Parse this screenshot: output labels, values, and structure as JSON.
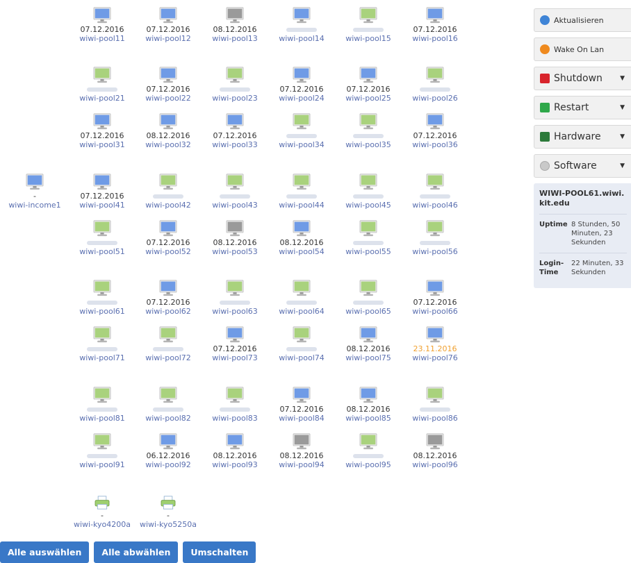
{
  "colors": {
    "monitor_blue": "#6f9be6",
    "monitor_green": "#a9d27d",
    "monitor_gray": "#9a9a9a",
    "link": "#5a6fb0",
    "button_blue": "#3978c7",
    "date_warning": "#f0a030"
  },
  "hosts": [
    {
      "name": "wiwi-income1",
      "date": "-",
      "state": "blue",
      "col": 0,
      "row": 3
    },
    {
      "name": "wiwi-pool11",
      "date": "07.12.2016",
      "state": "blue",
      "col": 1,
      "row": 0
    },
    {
      "name": "wiwi-pool12",
      "date": "07.12.2016",
      "state": "blue",
      "col": 2,
      "row": 0
    },
    {
      "name": "wiwi-pool13",
      "date": "08.12.2016",
      "state": "gray",
      "col": 3,
      "row": 0
    },
    {
      "name": "wiwi-pool14",
      "date": "",
      "state": "blue",
      "col": 4,
      "row": 0
    },
    {
      "name": "wiwi-pool15",
      "date": "",
      "state": "green",
      "col": 5,
      "row": 0
    },
    {
      "name": "wiwi-pool16",
      "date": "07.12.2016",
      "state": "blue",
      "col": 6,
      "row": 0
    },
    {
      "name": "wiwi-pool21",
      "date": "",
      "state": "green",
      "col": 1,
      "row": 1
    },
    {
      "name": "wiwi-pool22",
      "date": "07.12.2016",
      "state": "blue",
      "col": 2,
      "row": 1
    },
    {
      "name": "wiwi-pool23",
      "date": "",
      "state": "green",
      "col": 3,
      "row": 1
    },
    {
      "name": "wiwi-pool24",
      "date": "07.12.2016",
      "state": "blue",
      "col": 4,
      "row": 1
    },
    {
      "name": "wiwi-pool25",
      "date": "07.12.2016",
      "state": "blue",
      "col": 5,
      "row": 1
    },
    {
      "name": "wiwi-pool26",
      "date": "",
      "state": "green",
      "col": 6,
      "row": 1
    },
    {
      "name": "wiwi-pool31",
      "date": "07.12.2016",
      "state": "blue",
      "col": 1,
      "row": 2
    },
    {
      "name": "wiwi-pool32",
      "date": "08.12.2016",
      "state": "blue",
      "col": 2,
      "row": 2
    },
    {
      "name": "wiwi-pool33",
      "date": "07.12.2016",
      "state": "blue",
      "col": 3,
      "row": 2
    },
    {
      "name": "wiwi-pool34",
      "date": "",
      "state": "green",
      "col": 4,
      "row": 2
    },
    {
      "name": "wiwi-pool35",
      "date": "",
      "state": "green",
      "col": 5,
      "row": 2
    },
    {
      "name": "wiwi-pool36",
      "date": "07.12.2016",
      "state": "blue",
      "col": 6,
      "row": 2
    },
    {
      "name": "wiwi-pool41",
      "date": "07.12.2016",
      "state": "blue",
      "col": 1,
      "row": 3
    },
    {
      "name": "wiwi-pool42",
      "date": "",
      "state": "green",
      "col": 2,
      "row": 3
    },
    {
      "name": "wiwi-pool43",
      "date": "",
      "state": "green",
      "col": 3,
      "row": 3
    },
    {
      "name": "wiwi-pool44",
      "date": "",
      "state": "green",
      "col": 4,
      "row": 3
    },
    {
      "name": "wiwi-pool45",
      "date": "",
      "state": "green",
      "col": 5,
      "row": 3
    },
    {
      "name": "wiwi-pool46",
      "date": "",
      "state": "green",
      "col": 6,
      "row": 3
    },
    {
      "name": "wiwi-pool51",
      "date": "",
      "state": "green",
      "col": 1,
      "row": 4
    },
    {
      "name": "wiwi-pool52",
      "date": "07.12.2016",
      "state": "blue",
      "col": 2,
      "row": 4
    },
    {
      "name": "wiwi-pool53",
      "date": "08.12.2016",
      "state": "gray",
      "col": 3,
      "row": 4
    },
    {
      "name": "wiwi-pool54",
      "date": "08.12.2016",
      "state": "blue",
      "col": 4,
      "row": 4
    },
    {
      "name": "wiwi-pool55",
      "date": "",
      "state": "green",
      "col": 5,
      "row": 4
    },
    {
      "name": "wiwi-pool56",
      "date": "",
      "state": "green",
      "col": 6,
      "row": 4
    },
    {
      "name": "wiwi-pool61",
      "date": "",
      "state": "green",
      "col": 1,
      "row": 5
    },
    {
      "name": "wiwi-pool62",
      "date": "07.12.2016",
      "state": "blue",
      "col": 2,
      "row": 5
    },
    {
      "name": "wiwi-pool63",
      "date": "",
      "state": "green",
      "col": 3,
      "row": 5
    },
    {
      "name": "wiwi-pool64",
      "date": "",
      "state": "green",
      "col": 4,
      "row": 5
    },
    {
      "name": "wiwi-pool65",
      "date": "",
      "state": "green",
      "col": 5,
      "row": 5
    },
    {
      "name": "wiwi-pool66",
      "date": "07.12.2016",
      "state": "blue",
      "col": 6,
      "row": 5
    },
    {
      "name": "wiwi-pool71",
      "date": "",
      "state": "green",
      "col": 1,
      "row": 6
    },
    {
      "name": "wiwi-pool72",
      "date": "",
      "state": "green",
      "col": 2,
      "row": 6
    },
    {
      "name": "wiwi-pool73",
      "date": "07.12.2016",
      "state": "blue",
      "col": 3,
      "row": 6
    },
    {
      "name": "wiwi-pool74",
      "date": "",
      "state": "green",
      "col": 4,
      "row": 6
    },
    {
      "name": "wiwi-pool75",
      "date": "08.12.2016",
      "state": "blue",
      "col": 5,
      "row": 6
    },
    {
      "name": "wiwi-pool76",
      "date": "23.11.2016",
      "state": "blue",
      "warn": true,
      "col": 6,
      "row": 6
    },
    {
      "name": "wiwi-pool81",
      "date": "",
      "state": "green",
      "col": 1,
      "row": 7
    },
    {
      "name": "wiwi-pool82",
      "date": "",
      "state": "green",
      "col": 2,
      "row": 7
    },
    {
      "name": "wiwi-pool83",
      "date": "",
      "state": "green",
      "col": 3,
      "row": 7
    },
    {
      "name": "wiwi-pool84",
      "date": "07.12.2016",
      "state": "blue",
      "col": 4,
      "row": 7
    },
    {
      "name": "wiwi-pool85",
      "date": "08.12.2016",
      "state": "blue",
      "col": 5,
      "row": 7
    },
    {
      "name": "wiwi-pool86",
      "date": "",
      "state": "green",
      "col": 6,
      "row": 7
    },
    {
      "name": "wiwi-pool91",
      "date": "",
      "state": "green",
      "col": 1,
      "row": 8
    },
    {
      "name": "wiwi-pool92",
      "date": "06.12.2016",
      "state": "blue",
      "col": 2,
      "row": 8
    },
    {
      "name": "wiwi-pool93",
      "date": "08.12.2016",
      "state": "blue",
      "col": 3,
      "row": 8
    },
    {
      "name": "wiwi-pool94",
      "date": "08.12.2016",
      "state": "gray",
      "col": 4,
      "row": 8
    },
    {
      "name": "wiwi-pool95",
      "date": "",
      "state": "green",
      "col": 5,
      "row": 8
    },
    {
      "name": "wiwi-pool96",
      "date": "08.12.2016",
      "state": "gray",
      "col": 6,
      "row": 8
    }
  ],
  "printers": [
    {
      "name": "wiwi-kyo4200a",
      "date": "-",
      "col": 1
    },
    {
      "name": "wiwi-kyo5250a",
      "date": "-",
      "col": 2
    }
  ],
  "panel": {
    "refresh_label": "Aktualisieren",
    "wol_label": "Wake On Lan",
    "shutdown_label": "Shutdown",
    "restart_label": "Restart",
    "hardware_label": "Hardware",
    "software_label": "Software",
    "info": {
      "hostname": "WIWI-POOL61.wiwi.kit.edu",
      "uptime_label": "Uptime",
      "uptime_value": "8 Stunden, 50 Minuten, 23 Sekunden",
      "login_label": "Login-Time",
      "login_value": "22 Minuten, 33 Sekunden"
    }
  },
  "actions": {
    "select_all": "Alle auswählen",
    "deselect_all": "Alle abwählen",
    "toggle": "Umschalten"
  }
}
